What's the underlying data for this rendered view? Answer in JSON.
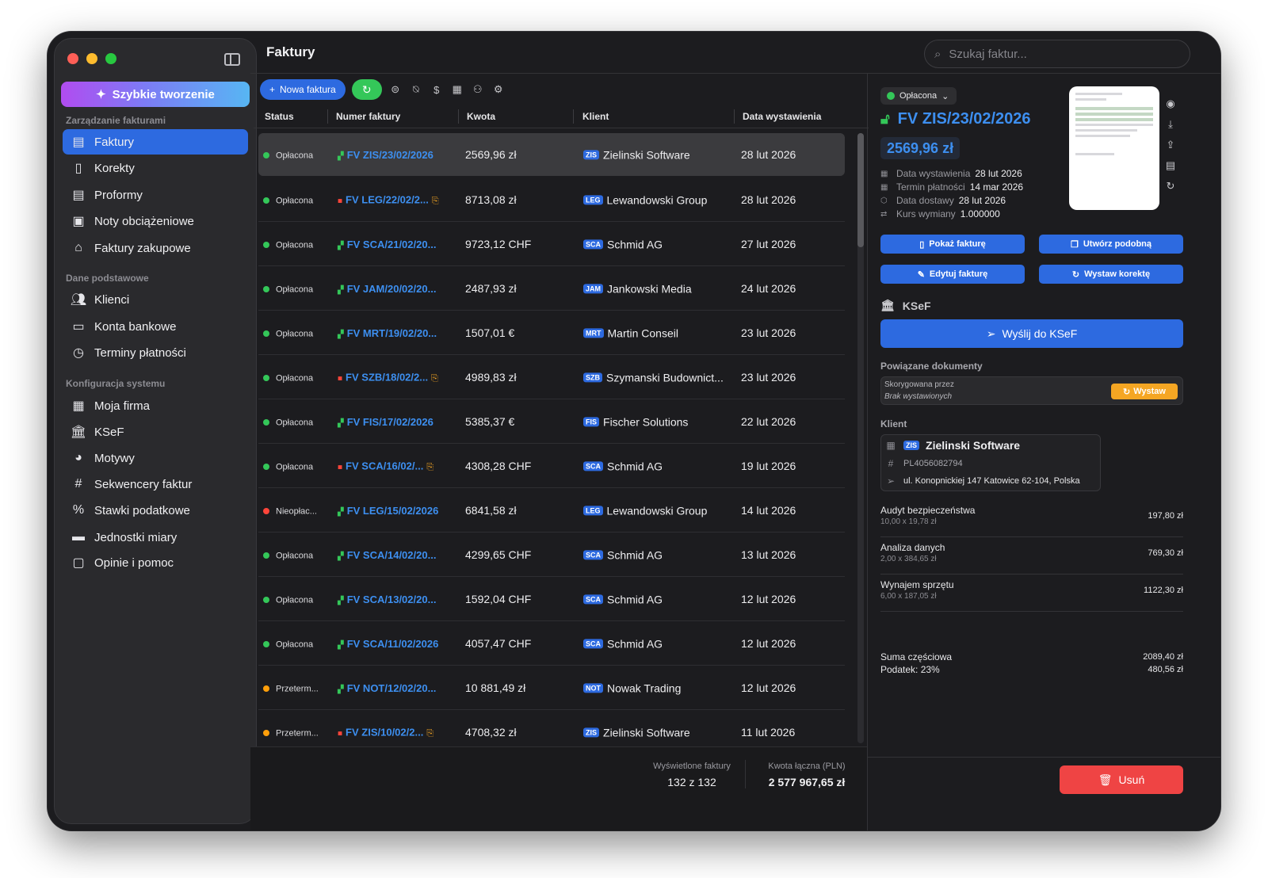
{
  "app": {
    "title": "Faktury"
  },
  "search": {
    "placeholder": "Szukaj faktur..."
  },
  "sidebar": {
    "quick_create": "Szybkie tworzenie",
    "sections": [
      {
        "title": "Zarządzanie fakturami",
        "items": [
          {
            "label": "Faktury",
            "icon": "document-icon",
            "active": true
          },
          {
            "label": "Korekty",
            "icon": "search-document-icon"
          },
          {
            "label": "Proformy",
            "icon": "proforma-icon"
          },
          {
            "label": "Noty obciążeniowe",
            "icon": "debit-note-icon"
          },
          {
            "label": "Faktury zakupowe",
            "icon": "purchase-icon"
          }
        ]
      },
      {
        "title": "Dane podstawowe",
        "items": [
          {
            "label": "Klienci",
            "icon": "people-icon"
          },
          {
            "label": "Konta bankowe",
            "icon": "bank-card-icon"
          },
          {
            "label": "Terminy płatności",
            "icon": "clock-icon"
          }
        ]
      },
      {
        "title": "Konfiguracja systemu",
        "items": [
          {
            "label": "Moja firma",
            "icon": "building-icon"
          },
          {
            "label": "KSeF",
            "icon": "institution-icon"
          },
          {
            "label": "Motywy",
            "icon": "palette-icon"
          },
          {
            "label": "Sekwencery faktur",
            "icon": "hash-icon"
          },
          {
            "label": "Stawki podatkowe",
            "icon": "percent-icon"
          },
          {
            "label": "Jednostki miary",
            "icon": "ruler-icon"
          },
          {
            "label": "Opinie i pomoc",
            "icon": "help-icon"
          }
        ]
      }
    ]
  },
  "toolbar": {
    "new_invoice": "Nowa faktura"
  },
  "table": {
    "headers": {
      "status": "Status",
      "number": "Numer faktury",
      "amount": "Kwota",
      "client": "Klient",
      "date": "Data wystawienia"
    },
    "status_colors": {
      "paid": "#34c759",
      "unpaid": "#ff453a",
      "overdue": "#ff9f0a"
    },
    "rows": [
      {
        "status": "Opłacona",
        "kind": "paid",
        "locked": false,
        "number": "FV ZIS/23/02/2026",
        "doc": false,
        "amount": "2569,96 zł",
        "badge": "ZIS",
        "client": "Zielinski Software",
        "date": "28 lut 2026",
        "selected": true
      },
      {
        "status": "Opłacona",
        "kind": "paid",
        "locked": true,
        "number": "FV LEG/22/02/2...",
        "doc": true,
        "amount": "8713,08 zł",
        "badge": "LEG",
        "client": "Lewandowski Group",
        "date": "28 lut 2026"
      },
      {
        "status": "Opłacona",
        "kind": "paid",
        "locked": false,
        "number": "FV SCA/21/02/20...",
        "doc": false,
        "amount": "9723,12 CHF",
        "badge": "SCA",
        "client": "Schmid AG",
        "date": "27 lut 2026"
      },
      {
        "status": "Opłacona",
        "kind": "paid",
        "locked": false,
        "number": "FV JAM/20/02/20...",
        "doc": false,
        "amount": "2487,93 zł",
        "badge": "JAM",
        "client": "Jankowski Media",
        "date": "24 lut 2026"
      },
      {
        "status": "Opłacona",
        "kind": "paid",
        "locked": false,
        "number": "FV MRT/19/02/20...",
        "doc": false,
        "amount": "1507,01 €",
        "badge": "MRT",
        "client": "Martin Conseil",
        "date": "23 lut 2026"
      },
      {
        "status": "Opłacona",
        "kind": "paid",
        "locked": true,
        "number": "FV SZB/18/02/2...",
        "doc": true,
        "amount": "4989,83 zł",
        "badge": "SZB",
        "client": "Szymanski Budownict...",
        "date": "23 lut 2026"
      },
      {
        "status": "Opłacona",
        "kind": "paid",
        "locked": false,
        "number": "FV FIS/17/02/2026",
        "doc": false,
        "amount": "5385,37 €",
        "badge": "FIS",
        "client": "Fischer Solutions",
        "date": "22 lut 2026"
      },
      {
        "status": "Opłacona",
        "kind": "paid",
        "locked": true,
        "number": "FV SCA/16/02/...",
        "doc": true,
        "amount": "4308,28 CHF",
        "badge": "SCA",
        "client": "Schmid AG",
        "date": "19 lut 2026"
      },
      {
        "status": "Nieopłac...",
        "kind": "unpaid",
        "locked": false,
        "number": "FV LEG/15/02/2026",
        "doc": false,
        "amount": "6841,58 zł",
        "badge": "LEG",
        "client": "Lewandowski Group",
        "date": "14 lut 2026"
      },
      {
        "status": "Opłacona",
        "kind": "paid",
        "locked": false,
        "number": "FV SCA/14/02/20...",
        "doc": false,
        "amount": "4299,65 CHF",
        "badge": "SCA",
        "client": "Schmid AG",
        "date": "13 lut 2026"
      },
      {
        "status": "Opłacona",
        "kind": "paid",
        "locked": false,
        "number": "FV SCA/13/02/20...",
        "doc": false,
        "amount": "1592,04 CHF",
        "badge": "SCA",
        "client": "Schmid AG",
        "date": "12 lut 2026"
      },
      {
        "status": "Opłacona",
        "kind": "paid",
        "locked": false,
        "number": "FV SCA/11/02/2026",
        "doc": false,
        "amount": "4057,47 CHF",
        "badge": "SCA",
        "client": "Schmid AG",
        "date": "12 lut 2026"
      },
      {
        "status": "Przeterm...",
        "kind": "overdue",
        "locked": false,
        "number": "FV NOT/12/02/20...",
        "doc": false,
        "amount": "10 881,49 zł",
        "badge": "NOT",
        "client": "Nowak Trading",
        "date": "12 lut 2026"
      },
      {
        "status": "Przeterm...",
        "kind": "overdue",
        "locked": true,
        "number": "FV ZIS/10/02/2...",
        "doc": true,
        "amount": "4708,32 zł",
        "badge": "ZIS",
        "client": "Zielinski Software",
        "date": "11 lut 2026"
      }
    ]
  },
  "footer": {
    "shown_label": "Wyświetlone faktury",
    "shown_value": "132 z 132",
    "total_label": "Kwota łączna (PLN)",
    "total_value": "2 577 967,65 zł"
  },
  "detail": {
    "status": "Opłacona",
    "number": "FV ZIS/23/02/2026",
    "amount": "2569,96 zł",
    "meta": [
      {
        "key": "Data wystawienia",
        "value": "28 lut 2026",
        "icon": "calendar-icon"
      },
      {
        "key": "Termin płatności",
        "value": "14 mar 2026",
        "icon": "calendar-due-icon"
      },
      {
        "key": "Data dostawy",
        "value": "28 lut 2026",
        "icon": "box-icon"
      },
      {
        "key": "Kurs wymiany",
        "value": "1.000000",
        "icon": "exchange-icon"
      }
    ],
    "actions": {
      "show": "Pokaż fakturę",
      "similar": "Utwórz podobną",
      "edit": "Edytuj fakturę",
      "correction": "Wystaw korektę"
    },
    "ksef": {
      "title": "KSeF",
      "send": "Wyślij do KSeF"
    },
    "related": {
      "title": "Powiązane dokumenty",
      "key": "Skorygowana przez",
      "value": "Brak wystawionych",
      "issue": "Wystaw"
    },
    "client": {
      "title": "Klient",
      "badge": "ZIS",
      "name": "Zielinski Software",
      "nip": "PL4056082794",
      "address": "ul. Konopnickiej 147 Katowice 62-104, Polska"
    },
    "items": [
      {
        "name": "Audyt bezpieczeństwa",
        "qty": "10,00 x 19,78 zł",
        "amount": "197,80 zł"
      },
      {
        "name": "Analiza danych",
        "qty": "2,00 x 384,65 zł",
        "amount": "769,30 zł"
      },
      {
        "name": "Wynajem sprzętu",
        "qty": "6,00 x 187,05 zł",
        "amount": "1122,30 zł"
      }
    ],
    "subtotal_label": "Suma częściowa",
    "subtotal_value": "2089,40 zł",
    "tax_label": "Podatek: 23%",
    "tax_value": "480,56 zł",
    "delete": "Usuń"
  }
}
